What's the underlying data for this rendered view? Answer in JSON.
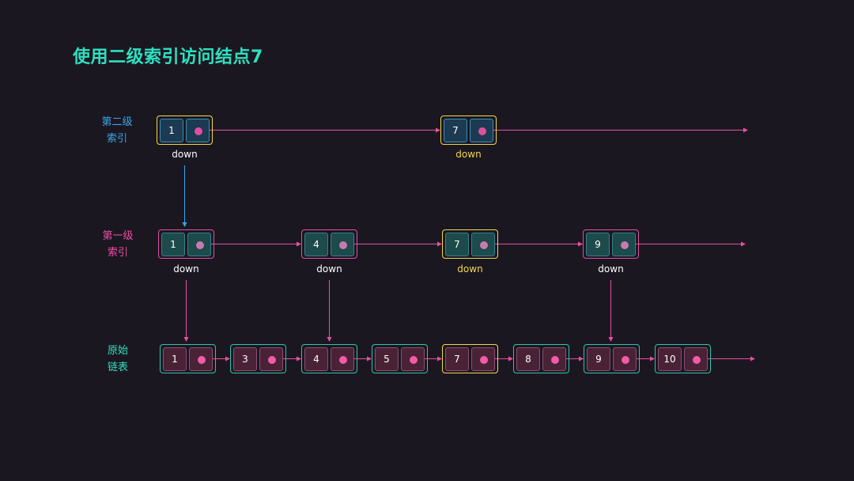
{
  "title": "使用二级索引访问结点7",
  "colors": {
    "background": "#1b1721",
    "title": "#2ee0c0",
    "level2_label": "#3aa6e8",
    "level1_label": "#e94fa0",
    "base_label": "#2ee0c0",
    "highlight": "#f2d94a",
    "arrow_pink": "#e94fa0",
    "arrow_blue": "#3aa6e8"
  },
  "rows": [
    {
      "id": "level2",
      "label_line1": "第二级",
      "label_line2": "索引",
      "label_color": "#3aa6e8",
      "node_border": "#3aa6e8",
      "cell_fill": "#1c3a52",
      "dot_color": "#e04fa0",
      "show_down": true,
      "nodes": [
        {
          "value": "1",
          "down": "down",
          "highlight": true
        },
        {
          "value": "7",
          "down": "down",
          "highlight": true
        }
      ]
    },
    {
      "id": "level1",
      "label_line1": "第一级",
      "label_line2": "索引",
      "label_color": "#e94fa0",
      "node_border": "#e04fa0",
      "cell_fill": "#1d4a4a",
      "dot_color": "#c87ab0",
      "show_down": true,
      "nodes": [
        {
          "value": "1",
          "down": "down",
          "highlight": false
        },
        {
          "value": "4",
          "down": "down",
          "highlight": false
        },
        {
          "value": "7",
          "down": "down",
          "highlight": true
        },
        {
          "value": "9",
          "down": "down",
          "highlight": false
        }
      ]
    },
    {
      "id": "base",
      "label_line1": "原始",
      "label_line2": "链表",
      "label_color": "#2ee0c0",
      "node_border": "#2ec4b0",
      "cell_fill": "#4a2236",
      "dot_color": "#f05ca8",
      "show_down": false,
      "nodes": [
        {
          "value": "1",
          "highlight": false
        },
        {
          "value": "3",
          "highlight": false
        },
        {
          "value": "4",
          "highlight": false
        },
        {
          "value": "5",
          "highlight": false
        },
        {
          "value": "7",
          "highlight": true
        },
        {
          "value": "8",
          "highlight": false
        },
        {
          "value": "9",
          "highlight": false
        },
        {
          "value": "10",
          "highlight": false
        }
      ]
    }
  ]
}
